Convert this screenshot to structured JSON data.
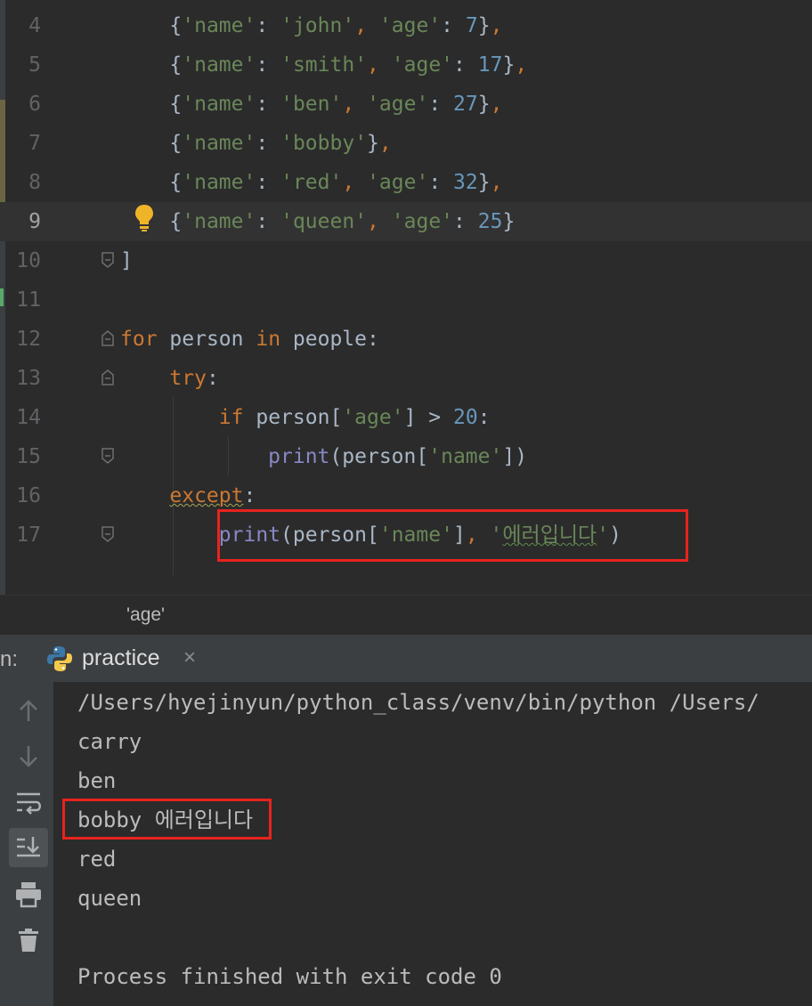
{
  "editor": {
    "lines": [
      {
        "num": "4"
      },
      {
        "num": "5"
      },
      {
        "num": "6"
      },
      {
        "num": "7"
      },
      {
        "num": "8"
      },
      {
        "num": "9"
      },
      {
        "num": "10"
      },
      {
        "num": "11"
      },
      {
        "num": "12"
      },
      {
        "num": "13"
      },
      {
        "num": "14"
      },
      {
        "num": "15"
      },
      {
        "num": "16"
      },
      {
        "num": "17"
      }
    ],
    "tokens": {
      "lbrace": "{",
      "rbrace": "}",
      "comma": ",",
      "colon": ":",
      "q": "'",
      "name": "name",
      "age": "age",
      "john": "john",
      "smith": "smith",
      "ben": "ben",
      "bobby": "bobby",
      "red": "red",
      "queen": "queen",
      "v7": "7",
      "v17": "17",
      "v27": "27",
      "v32": "32",
      "v25": "25",
      "rbracket": "]",
      "for": "for",
      "person": "person",
      "in": "in",
      "people": "people",
      "try": "try",
      "if": "if",
      "lbr": "[",
      "gt": ">",
      "v20": "20",
      "print": "print",
      "lparen": "(",
      "rparen": ")",
      "except": "except",
      "error_msg": "에러입니다"
    },
    "highlight_color": "#e8231e"
  },
  "breadcrumb": "'age'",
  "run_panel": {
    "prefix": "n:",
    "tab_label": "practice",
    "tab_close": "×",
    "output": [
      "/Users/hyejinyun/python_class/venv/bin/python /Users/",
      "carry",
      "ben",
      "bobby 에러입니다",
      "red",
      "queen",
      "",
      "Process finished with exit code 0"
    ],
    "toolbar": [
      "up-arrow-icon",
      "down-arrow-icon",
      "soft-wrap-icon",
      "scroll-to-end-icon",
      "print-icon",
      "trash-icon"
    ]
  },
  "colors": {
    "background": "#2b2b2b",
    "keyword": "#cc7832",
    "string": "#6a8759",
    "number": "#6897bb",
    "builtin": "#8888c6",
    "text": "#a9b7c6"
  }
}
